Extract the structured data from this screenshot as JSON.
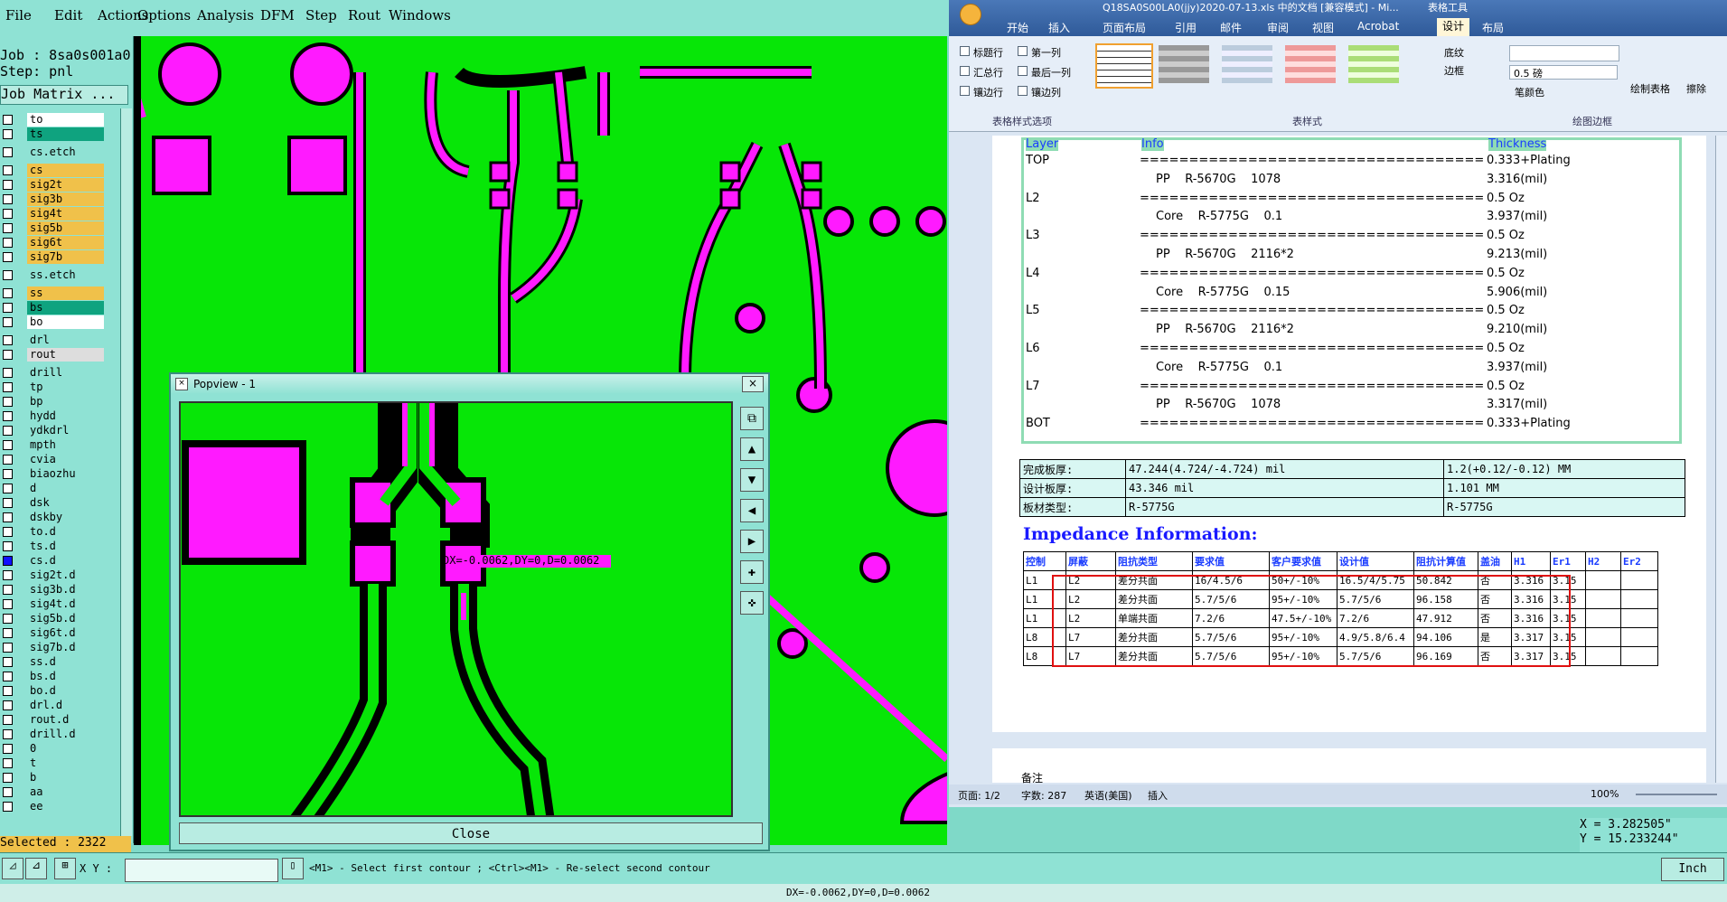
{
  "menubar": [
    "File",
    "Edit",
    "Actions",
    "Options",
    "Analysis",
    "DFM",
    "Step",
    "Rout",
    "Windows"
  ],
  "job": {
    "job_line": "Job : 8sa0s001a0",
    "step_line": "Step: pnl",
    "matrix_btn": "Job Matrix ..."
  },
  "layers": [
    {
      "name": "to",
      "color": "#ffffff"
    },
    {
      "name": "ts",
      "color": "#0fa37f"
    },
    {
      "name": "cs.etch",
      "color": "#8fe2d4"
    },
    {
      "name": "cs",
      "color": "#f0c14a"
    },
    {
      "name": "sig2t",
      "color": "#f0c14a"
    },
    {
      "name": "sig3b",
      "color": "#f0c14a"
    },
    {
      "name": "sig4t",
      "color": "#f0c14a"
    },
    {
      "name": "sig5b",
      "color": "#f0c14a"
    },
    {
      "name": "sig6t",
      "color": "#f0c14a"
    },
    {
      "name": "sig7b",
      "color": "#f0c14a"
    },
    {
      "name": "ss.etch",
      "color": "#8fe2d4"
    },
    {
      "name": "ss",
      "color": "#f0c14a"
    },
    {
      "name": "bs",
      "color": "#0fa37f"
    },
    {
      "name": "bo",
      "color": "#ffffff"
    },
    {
      "name": "drl",
      "color": "#8fe2d4"
    },
    {
      "name": "rout",
      "color": "#dddddd"
    },
    {
      "name": "drill",
      "color": "#8fe2d4"
    },
    {
      "name": "tp",
      "color": "#8fe2d4"
    },
    {
      "name": "bp",
      "color": "#8fe2d4"
    },
    {
      "name": "hydd",
      "color": "#8fe2d4"
    },
    {
      "name": "ydkdrl",
      "color": "#8fe2d4"
    },
    {
      "name": "mpth",
      "color": "#8fe2d4"
    },
    {
      "name": "cvia",
      "color": "#8fe2d4"
    },
    {
      "name": "biaozhu",
      "color": "#8fe2d4"
    },
    {
      "name": "d",
      "color": "#8fe2d4"
    },
    {
      "name": "dsk",
      "color": "#8fe2d4"
    },
    {
      "name": "dskby",
      "color": "#8fe2d4"
    },
    {
      "name": "to.d",
      "color": "#8fe2d4"
    },
    {
      "name": "ts.d",
      "color": "#8fe2d4"
    },
    {
      "name": "cs.d",
      "color": "#8fe2d4"
    },
    {
      "name": "sig2t.d",
      "color": "#8fe2d4"
    },
    {
      "name": "sig3b.d",
      "color": "#8fe2d4"
    },
    {
      "name": "sig4t.d",
      "color": "#8fe2d4"
    },
    {
      "name": "sig5b.d",
      "color": "#8fe2d4"
    },
    {
      "name": "sig6t.d",
      "color": "#8fe2d4"
    },
    {
      "name": "sig7b.d",
      "color": "#8fe2d4"
    },
    {
      "name": "ss.d",
      "color": "#8fe2d4"
    },
    {
      "name": "bs.d",
      "color": "#8fe2d4"
    },
    {
      "name": "bo.d",
      "color": "#8fe2d4"
    },
    {
      "name": "drl.d",
      "color": "#8fe2d4"
    },
    {
      "name": "rout.d",
      "color": "#8fe2d4"
    },
    {
      "name": "drill.d",
      "color": "#8fe2d4"
    },
    {
      "name": "0",
      "color": "#8fe2d4"
    },
    {
      "name": "t",
      "color": "#8fe2d4"
    },
    {
      "name": "b",
      "color": "#8fe2d4"
    },
    {
      "name": "aa",
      "color": "#8fe2d4"
    },
    {
      "name": "ee",
      "color": "#8fe2d4"
    }
  ],
  "selected": "Selected : 2322",
  "popview": {
    "title": "Popview - 1",
    "close": "Close",
    "measure": "DX=-0.0062,DY=0,D=0.0062"
  },
  "word": {
    "title": "Q18SA0S00LA0(jjy)2020-07-13.xls 中的文档 [兼容模式] - Mi...",
    "context_tab": "表格工具",
    "tabs": [
      "开始",
      "插入",
      "页面布局",
      "引用",
      "邮件",
      "审阅",
      "视图",
      "Acrobat",
      "设计",
      "布局"
    ],
    "checkboxes": [
      "标题行",
      "第一列",
      "汇总行",
      "最后一列",
      "镶边行",
      "镶边列"
    ],
    "groups": [
      "表格样式选项",
      "表样式",
      "绘图边框"
    ],
    "shading": "底纹",
    "borders": "边框",
    "pen_weight": "0.5 磅",
    "pen_color": "笔颜色",
    "draw_table": "绘制表格",
    "eraser": "擦除",
    "stack_header": [
      "Layer",
      "Info",
      "Thickness"
    ],
    "stack": [
      [
        "TOP",
        "===================================",
        "0.333+Plating"
      ],
      [
        "",
        "PP    R-5670G    1078",
        "3.316(mil)"
      ],
      [
        "L2",
        "===================================",
        "0.5 Oz"
      ],
      [
        "",
        "Core    R-5775G    0.1",
        "3.937(mil)"
      ],
      [
        "L3",
        "===================================",
        "0.5 Oz"
      ],
      [
        "",
        "PP    R-5670G    2116*2",
        "9.213(mil)"
      ],
      [
        "L4",
        "===================================",
        "0.5 Oz"
      ],
      [
        "",
        "Core    R-5775G    0.15",
        "5.906(mil)"
      ],
      [
        "L5",
        "===================================",
        "0.5 Oz"
      ],
      [
        "",
        "PP    R-5670G    2116*2",
        "9.210(mil)"
      ],
      [
        "L6",
        "===================================",
        "0.5 Oz"
      ],
      [
        "",
        "Core    R-5775G    0.1",
        "3.937(mil)"
      ],
      [
        "L7",
        "===================================",
        "0.5 Oz"
      ],
      [
        "",
        "PP    R-5670G    1078",
        "3.317(mil)"
      ],
      [
        "BOT",
        "===================================",
        "0.333+Plating"
      ]
    ],
    "summary": [
      [
        "完成板厚:",
        "47.244(4.724/-4.724) mil",
        "1.2(+0.12/-0.12) MM"
      ],
      [
        "设计板厚:",
        "43.346 mil",
        "1.101 MM"
      ],
      [
        "板材类型:",
        "R-5775G",
        "R-5775G"
      ]
    ],
    "impedance_title": "Impedance Information:",
    "imp_header": [
      "控制",
      "屏蔽",
      "阻抗类型",
      "要求值",
      "客户要求值",
      "设计值",
      "阻抗计算值",
      "盖油",
      "H1",
      "Er1",
      "H2",
      "Er2"
    ],
    "imp_rows": [
      [
        "L1",
        "L2",
        "差分共面",
        "16/4.5/6",
        "50+/-10%",
        "16.5/4/5.75",
        "50.842",
        "否",
        "3.316",
        "3.15",
        "",
        ""
      ],
      [
        "L1",
        "L2",
        "差分共面",
        "5.7/5/6",
        "95+/-10%",
        "5.7/5/6",
        "96.158",
        "否",
        "3.316",
        "3.15",
        "",
        ""
      ],
      [
        "L1",
        "L2",
        "单端共面",
        "7.2/6",
        "47.5+/-10%",
        "7.2/6",
        "47.912",
        "否",
        "3.316",
        "3.15",
        "",
        ""
      ],
      [
        "L8",
        "L7",
        "差分共面",
        "5.7/5/6",
        "95+/-10%",
        "4.9/5.8/6.4",
        "94.106",
        "是",
        "3.317",
        "3.15",
        "",
        ""
      ],
      [
        "L8",
        "L7",
        "差分共面",
        "5.7/5/6",
        "95+/-10%",
        "5.7/5/6",
        "96.169",
        "否",
        "3.317",
        "3.15",
        "",
        ""
      ]
    ],
    "next_page": "备注",
    "status": [
      "页面: 1/2",
      "字数: 287",
      "英语(美国)",
      "插入"
    ],
    "zoom": "100%"
  },
  "coords": {
    "x": "X = 3.282505\"",
    "y": "Y = 15.233244\""
  },
  "cmd": {
    "xy_label": "X Y :",
    "xy_value": "",
    "prompt": "<M1> - Select first contour ; <Ctrl><M1> - Re-select second contour",
    "units": "Inch"
  },
  "footer": "DX=-0.0062,DY=0,D=0.0062"
}
